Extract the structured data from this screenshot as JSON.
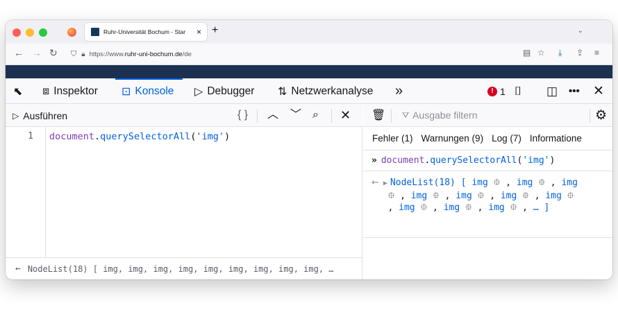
{
  "browser": {
    "tab_title": "Ruhr-Universität Bochum - Star",
    "tab_close": "×",
    "new_tab": "+",
    "tab_list": "⌄",
    "url_prefix": "https://www.",
    "url_host": "ruhr-uni-bochum.de",
    "url_path": "/de"
  },
  "devtools": {
    "tools": [
      {
        "label": "Inspektor",
        "icon": "inspector-icon"
      },
      {
        "label": "Konsole",
        "icon": "console-icon",
        "active": true
      },
      {
        "label": "Debugger",
        "icon": "debugger-icon"
      },
      {
        "label": "Netzwerkanalyse",
        "icon": "network-icon"
      }
    ],
    "more_tools": "»",
    "error_count": "1",
    "error_badge": "!"
  },
  "editor": {
    "run_label": "Ausführen",
    "line_number": "1",
    "code": {
      "obj": "document",
      "dot": ".",
      "fn": "querySelectorAll",
      "open": "(",
      "arg": "'img'",
      "close": ")"
    },
    "result_preview": "NodeList(18) [ img, img, img, img, img, img, img, img, img, …"
  },
  "console": {
    "filter_placeholder": "Ausgabe filtern",
    "tabs": [
      "Fehler (1)",
      "Warnungen (9)",
      "Log (7)",
      "Informatione"
    ],
    "input_echo": {
      "obj": "document",
      "dot": ".",
      "fn": "querySelectorAll",
      "open": "(",
      "arg": "'img'",
      "close": ")"
    },
    "result": {
      "type": "NodeList(18)",
      "open": "[",
      "item": "img",
      "ellipsis": "…",
      "close": "]"
    }
  },
  "colors": {
    "accent": "#0061e0",
    "error": "#d70022",
    "page_header": "#1c3151"
  }
}
